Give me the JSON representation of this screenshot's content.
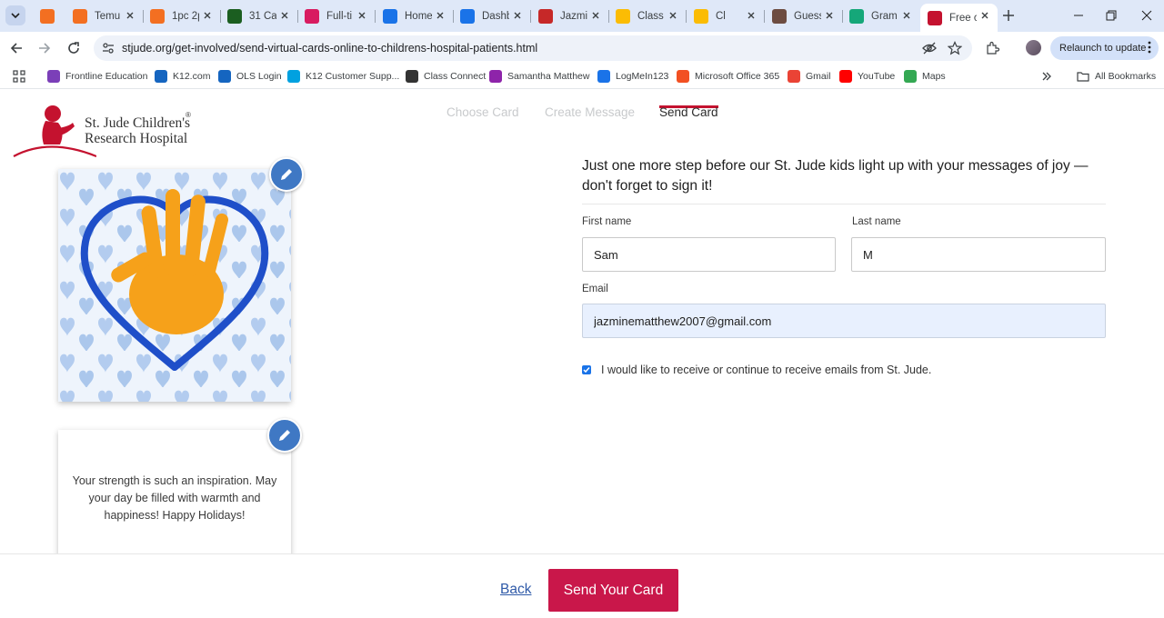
{
  "browser": {
    "tabs": [
      {
        "label": "",
        "color": "#f36f21",
        "active": false
      },
      {
        "label": "Temu",
        "color": "#f36f21",
        "active": false
      },
      {
        "label": "1pc 2p",
        "color": "#f36f21",
        "active": false
      },
      {
        "label": "31 Ca",
        "color": "#1b5e20",
        "active": false
      },
      {
        "label": "Full-ti",
        "color": "#d81b60",
        "active": false
      },
      {
        "label": "Home",
        "color": "#1a73e8",
        "active": false
      },
      {
        "label": "Dashb",
        "color": "#1a73e8",
        "active": false
      },
      {
        "label": "Jazmi",
        "color": "#c62828",
        "active": false
      },
      {
        "label": "Class",
        "color": "#fbbc04",
        "active": false
      },
      {
        "label": "Cl",
        "color": "#fbbc04",
        "active": false
      },
      {
        "label": "Guess",
        "color": "#6d4c41",
        "active": false
      },
      {
        "label": "Gram",
        "color": "#15a779",
        "active": false
      },
      {
        "label": "Free c",
        "color": "#c4122f",
        "active": true
      }
    ],
    "url": "stjude.org/get-involved/send-virtual-cards-online-to-childrens-hospital-patients.html",
    "relaunch_label": "Relaunch to update",
    "bookmarks": [
      {
        "label": "Frontline Education",
        "icon": "frontline-icon",
        "color": "#7b3fb8"
      },
      {
        "label": "K12.com",
        "icon": "k12-icon",
        "color": "#1565c0"
      },
      {
        "label": "OLS Login",
        "icon": "k12-icon",
        "color": "#1565c0"
      },
      {
        "label": "K12 Customer Supp...",
        "icon": "salesforce-icon",
        "color": "#00a1e0"
      },
      {
        "label": "Class Connect",
        "icon": "class-connect-icon",
        "color": "#333333"
      },
      {
        "label": "Samantha Matthew",
        "icon": "people-icon",
        "color": "#8e24aa"
      },
      {
        "label": "LogMeIn123",
        "icon": "logmein-icon",
        "color": "#1a73e8"
      },
      {
        "label": "Microsoft Office 365",
        "icon": "microsoft-icon",
        "color": "#f25022"
      },
      {
        "label": "Gmail",
        "icon": "gmail-icon",
        "color": "#ea4335"
      },
      {
        "label": "YouTube",
        "icon": "youtube-icon",
        "color": "#ff0000"
      },
      {
        "label": "Maps",
        "icon": "maps-icon",
        "color": "#34a853"
      }
    ],
    "all_bookmarks_label": "All Bookmarks"
  },
  "site": {
    "logo_line1": "St. Jude Children's",
    "logo_line2": "Research Hospital",
    "logo_reg": "®",
    "brand_color": "#c4122f"
  },
  "steps": {
    "choose": "Choose Card",
    "create": "Create Message",
    "send": "Send Card"
  },
  "card": {
    "message": "Your strength is such an inspiration. May your day be filled with warmth and happiness! Happy Holidays!"
  },
  "form": {
    "headline": "Just one more step before our St. Jude kids light up with your messages of joy — don't forget to sign it!",
    "first_name_label": "First name",
    "first_name_value": "Sam",
    "last_name_label": "Last name",
    "last_name_value": "M",
    "email_label": "Email",
    "email_value": "jazminematthew2007@gmail.com",
    "optin_label": "I would like to receive or continue to receive emails from St. Jude.",
    "optin_checked": true
  },
  "footer": {
    "back_label": "Back",
    "send_label": "Send Your Card",
    "send_color": "#c9174a"
  }
}
